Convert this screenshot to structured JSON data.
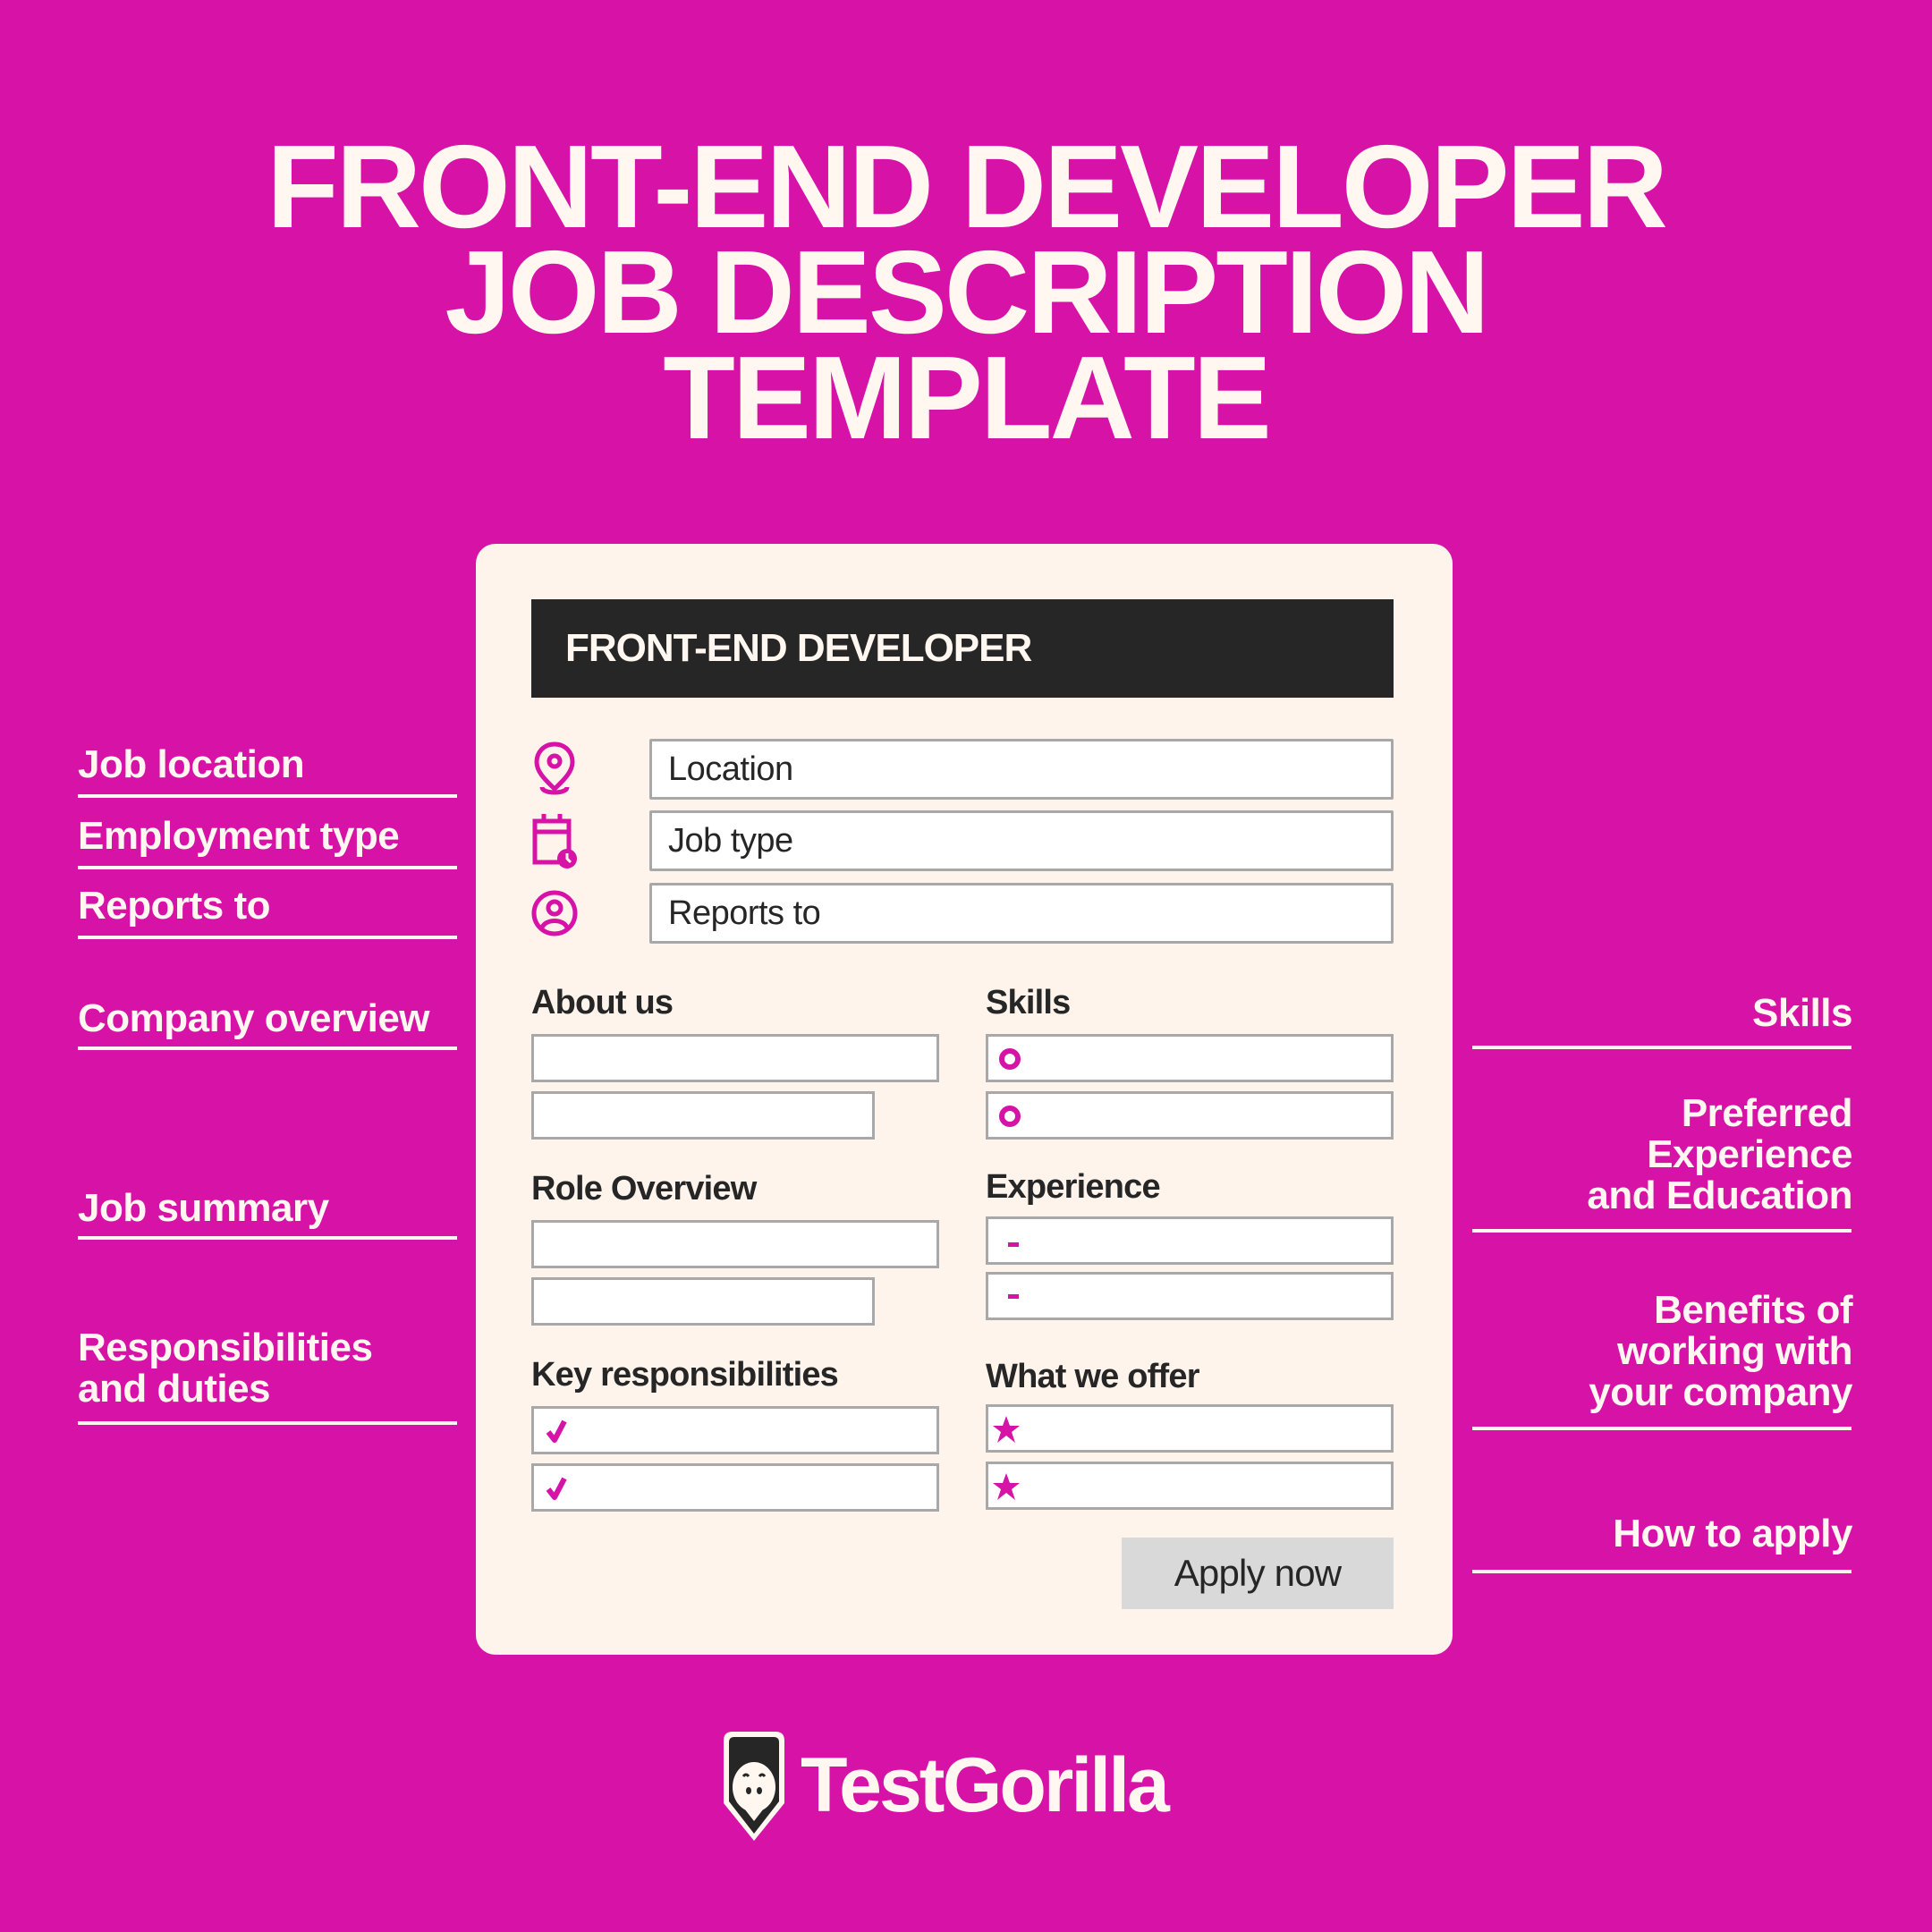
{
  "title": {
    "lines": [
      "FRONT-END DEVELOPER",
      "JOB DESCRIPTION",
      "TEMPLATE"
    ]
  },
  "left_labels": [
    {
      "text": "Job location"
    },
    {
      "text": "Employment type"
    },
    {
      "text": "Reports to"
    },
    {
      "text": "Company overview"
    },
    {
      "text": "Job summary"
    },
    {
      "text": "Responsibilities\nand duties"
    }
  ],
  "right_labels": [
    {
      "text": "Skills"
    },
    {
      "text": "Preferred\nExperience\nand Education"
    },
    {
      "text": "Benefits of\nworking with\nyour company"
    },
    {
      "text": "How to apply"
    }
  ],
  "card": {
    "header": "FRONT-END DEVELOPER",
    "info_rows": [
      {
        "icon": "location-pin-icon",
        "value": "Location"
      },
      {
        "icon": "calendar-clock-icon",
        "value": "Job type"
      },
      {
        "icon": "user-circle-icon",
        "value": "Reports to"
      }
    ],
    "sections": {
      "about_us": "About us",
      "skills": "Skills",
      "role_overview": "Role Overview",
      "experience": "Experience",
      "key_responsibilities": "Key responsibilities",
      "what_we_offer": "What we offer"
    },
    "apply_button": "Apply now"
  },
  "colors": {
    "background": "#d612a7",
    "accent": "#d612a7",
    "card": "#fef4ec",
    "header": "#262626",
    "text_light": "#fff7f0"
  },
  "logo": {
    "text": "TestGorilla"
  }
}
